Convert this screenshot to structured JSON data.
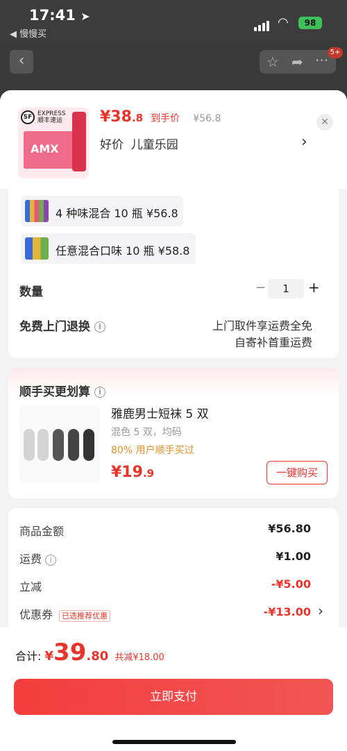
{
  "status": {
    "time": "17:41",
    "back_app": "◀ 慢慢买",
    "battery": "98"
  },
  "background": {
    "badge": "5+"
  },
  "product": {
    "price_big": "¥38",
    "price_small": ".8",
    "price_suffix": "到手价",
    "orig_price": "¥56.8",
    "tags": "好价  儿童乐园",
    "img_brand": "AMX",
    "sf_top": "EXPRESS",
    "sf_bottom": "顺丰速运"
  },
  "options": [
    {
      "label": "4 种味混合 10 瓶",
      "price": "¥56.8"
    },
    {
      "label": "任意混合口味 10 瓶",
      "price": "¥58.8"
    }
  ],
  "quantity": {
    "label": "数量",
    "minus": "−",
    "value": "1",
    "plus": "+"
  },
  "return": {
    "label": "免费上门退换",
    "line1": "上门取件享运费全免",
    "line2": "自寄补首重运费"
  },
  "addon": {
    "title": "顺手买更划算",
    "name": "雅鹿男士短袜 5 双",
    "spec": "混色 5 双，均码",
    "social": "80% 用户顺手买过",
    "price_big": "¥19",
    "price_small": ".9",
    "button": "一键购买"
  },
  "summary": [
    {
      "label": "商品金额",
      "value": "¥56.80",
      "red": false
    },
    {
      "label": "运费",
      "value": "¥1.00",
      "red": false,
      "info": true
    },
    {
      "label": "立减",
      "value": "-¥5.00",
      "red": true
    },
    {
      "label": "优惠券",
      "value": "-¥13.00",
      "red": true,
      "tag": "已选推荐优惠"
    }
  ],
  "footer": {
    "total_label": "合计:",
    "total_currency": "¥",
    "total_big": "39",
    "total_small": ".80",
    "saved": "共减¥18.00",
    "pay_button": "立即支付"
  },
  "colors": {
    "accent": "#e8352c",
    "price_orange": "#e0902a"
  }
}
